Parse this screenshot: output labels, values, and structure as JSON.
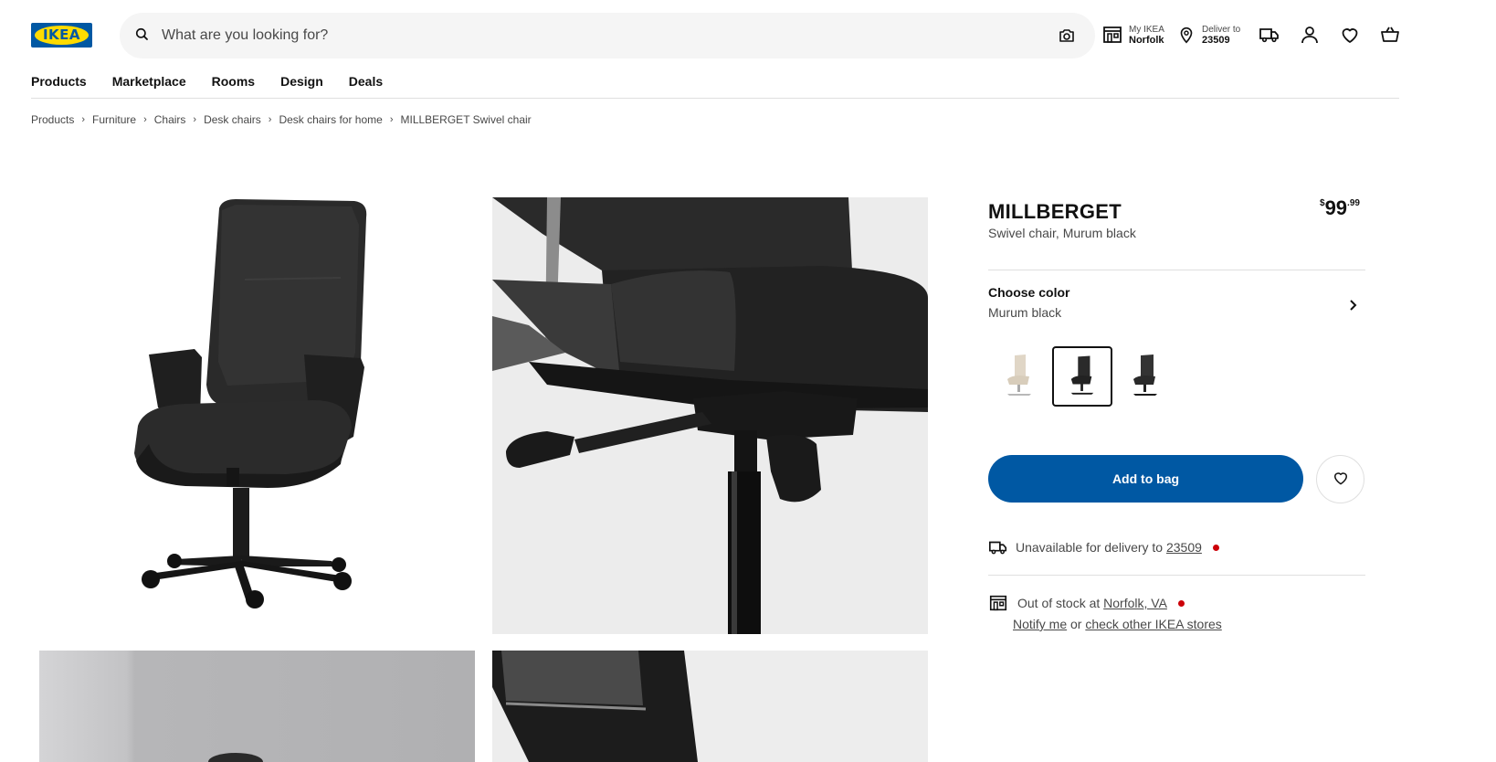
{
  "brand": {
    "logo_text": "IKEA",
    "color_blue": "#0058a3",
    "color_yellow": "#ffdb00"
  },
  "search": {
    "placeholder": "What are you looking for?"
  },
  "header": {
    "my_ikea_label": "My IKEA",
    "my_ikea_store": "Norfolk",
    "deliver_label": "Deliver to",
    "deliver_zip": "23509",
    "icons": [
      "search-icon",
      "camera-icon",
      "store-icon",
      "location-pin-icon",
      "delivery-truck-icon",
      "user-icon",
      "heart-icon",
      "shopping-bag-icon"
    ]
  },
  "nav": [
    "Products",
    "Marketplace",
    "Rooms",
    "Design",
    "Deals"
  ],
  "breadcrumbs": [
    "Products",
    "Furniture",
    "Chairs",
    "Desk chairs",
    "Desk chairs for home",
    "MILLBERGET Swivel chair"
  ],
  "product": {
    "name": "MILLBERGET",
    "description": "Swivel chair, Murum black",
    "price_currency": "$",
    "price_int": "99",
    "price_dec": ".99"
  },
  "color": {
    "title": "Choose color",
    "selected": "Murum black",
    "swatches": [
      "beige",
      "Murum black",
      "black"
    ],
    "selected_index": 1
  },
  "actions": {
    "add_to_bag": "Add to bag"
  },
  "availability": {
    "delivery_text": "Unavailable for delivery to",
    "delivery_zip": "23509",
    "store_text": "Out of stock at",
    "store_name": "Norfolk, VA",
    "notify_link": "Notify me",
    "or_text": "or",
    "check_link": "check other IKEA stores",
    "status_color": "#cc0008"
  }
}
